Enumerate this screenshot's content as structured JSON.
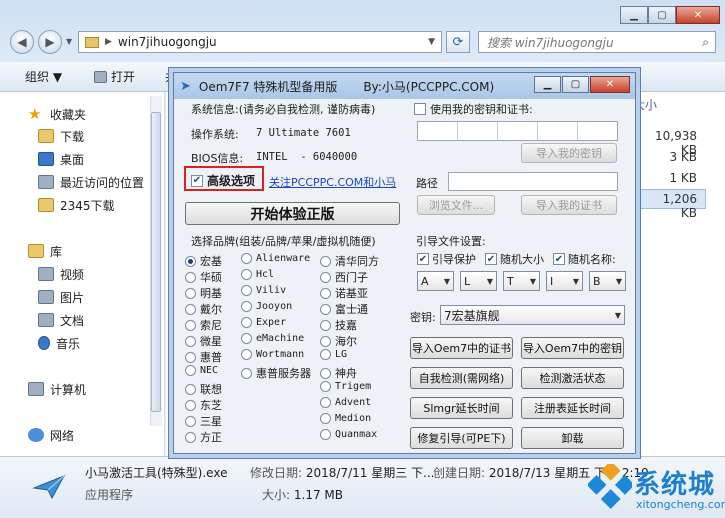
{
  "explorer": {
    "address_path": "win7jihuogongju",
    "search_placeholder": "搜索 win7jihuogongju",
    "toolbar": {
      "organize": "组织 ▼",
      "open": "打开",
      "share_partial": "共"
    },
    "column_size_header": "大小",
    "file_sizes": [
      "10,938 KB",
      "3 KB",
      "1 KB",
      "1,206 KB"
    ],
    "nav": {
      "favorites": "收藏夹",
      "favorites_items": [
        "下载",
        "桌面",
        "最近访问的位置",
        "2345下载"
      ],
      "libraries": "库",
      "libraries_items": [
        "视频",
        "图片",
        "文档",
        "音乐"
      ],
      "computer": "计算机",
      "network": "网络"
    },
    "status": {
      "filename": "小马激活工具(特殊型).exe",
      "modified_label": "修改日期:",
      "modified_value": "2018/7/11 星期三 下...",
      "created_label": "创建日期:",
      "created_value": "2018/7/13 星期五 下午 2:19",
      "type": "应用程序",
      "size_label": "大小:",
      "size_value": "1.17 MB"
    }
  },
  "dialog": {
    "title": "Oem7F7 特殊机型备用版",
    "author": "By:小马(PCCPPC.COM)",
    "sysinfo_label": "系统信息:(请务必自我检测, 谨防病毒)",
    "os_label": "操作系统:",
    "os_value": "7 Ultimate 7601",
    "bios_label": "BIOS信息:",
    "bios_value": "INTEL  - 6040000",
    "advanced_label": "高级选项",
    "follow_link": "关注PCCPPC.COM和小马",
    "start_button": "开始体验正版",
    "brand_label": "选择品牌(组装/品牌/苹果/虚拟机随便)",
    "brands_col1": [
      "宏基",
      "华硕",
      "明基",
      "戴尔",
      "索尼",
      "微星",
      "惠普",
      "NEC",
      "联想",
      "东芝",
      "三星",
      "方正"
    ],
    "brands_col2": [
      "Alienware",
      "Hcl",
      "Viliv",
      "Jooyon",
      "Exper",
      "eMachine",
      "Wortmann",
      "惠普服务器"
    ],
    "brands_col3": [
      "清华同方",
      "西门子",
      "诺基亚",
      "富士通",
      "技嘉",
      "海尔",
      "LG",
      "神舟",
      "Trigem",
      "Advent",
      "Medion",
      "Quanmax"
    ],
    "use_key_label": "使用我的密钥和证书:",
    "import_key": "导入我的密钥",
    "path_label": "路径",
    "browse": "浏览文件...",
    "import_cert": "导入我的证书",
    "boot_label": "引导文件设置:",
    "boot_protect": "引导保护",
    "random_size": "随机大小",
    "random_name": "随机名称:",
    "drive_letters": [
      "A",
      "L",
      "T",
      "I",
      "B"
    ],
    "key_label": "密钥:",
    "key_value": "7宏基旗舰",
    "btn_import_cert_oem": "导入Oem7中的证书",
    "btn_import_key_oem": "导入Oem7中的密钥",
    "btn_self_check": "自我检测(需网络)",
    "btn_check_activation": "检测激活状态",
    "btn_slmgr": "Slmgr延长时间",
    "btn_registry": "注册表延长时间",
    "btn_repair_boot": "修复引导(可PE下)",
    "btn_uninstall": "卸载"
  },
  "watermark": {
    "name": "系统城",
    "url": "xitongcheng.com"
  }
}
